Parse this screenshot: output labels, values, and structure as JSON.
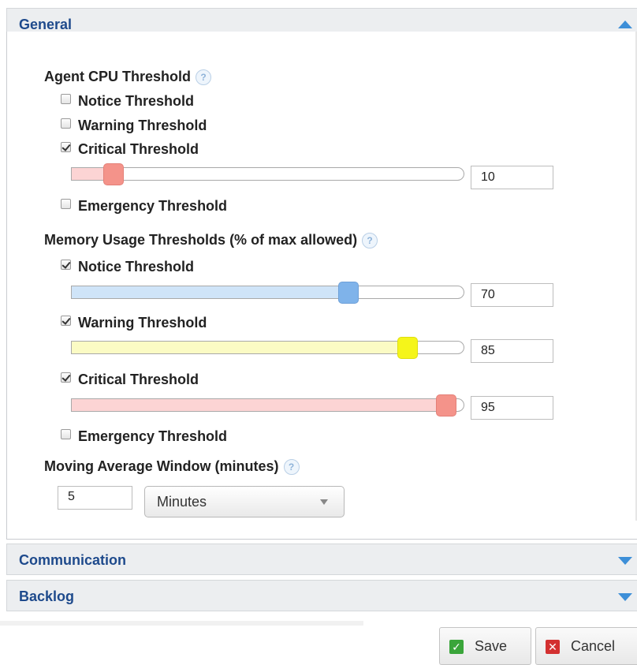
{
  "sections": {
    "general": "General",
    "communication": "Communication",
    "backlog": "Backlog"
  },
  "help_glyph": "?",
  "agent_cpu": {
    "label": "Agent CPU Threshold",
    "notice": {
      "label": "Notice Threshold",
      "checked": false
    },
    "warning": {
      "label": "Warning Threshold",
      "checked": false
    },
    "critical": {
      "label": "Critical Threshold",
      "checked": true,
      "value": "10"
    },
    "emergency": {
      "label": "Emergency Threshold",
      "checked": false
    }
  },
  "memory": {
    "label": "Memory Usage Thresholds (% of max allowed)",
    "notice": {
      "label": "Notice Threshold",
      "checked": true,
      "value": "70"
    },
    "warning": {
      "label": "Warning Threshold",
      "checked": true,
      "value": "85"
    },
    "critical": {
      "label": "Critical Threshold",
      "checked": true,
      "value": "95"
    },
    "emergency": {
      "label": "Emergency Threshold",
      "checked": false
    }
  },
  "moving_average": {
    "label": "Moving Average Window (minutes)",
    "value": "5",
    "unit": "Minutes"
  },
  "buttons": {
    "save": "Save",
    "cancel": "Cancel"
  },
  "colors": {
    "header_text": "#1e4a8c",
    "accent_blue": "#3d8fd8",
    "notice_fill": "#cfe4f8",
    "notice_handle": "#7fb3ea",
    "warning_fill": "#fbfbc4",
    "warning_handle": "#f5f51a",
    "critical_fill": "#fcd4d4",
    "critical_handle": "#f4938a",
    "save_icon": "#3aa53a",
    "cancel_icon": "#d33030"
  },
  "icons": {
    "general_toggle": "triangle-up-icon",
    "communication_toggle": "triangle-down-icon",
    "backlog_toggle": "triangle-down-icon",
    "save": "check-icon",
    "cancel": "x-icon",
    "help": "question-icon"
  }
}
